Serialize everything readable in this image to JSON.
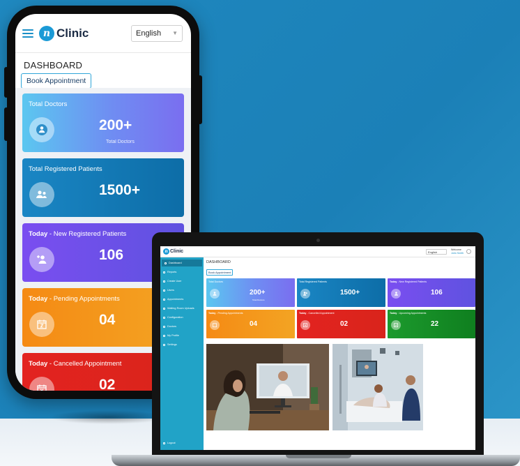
{
  "app": {
    "brand": "Clinic",
    "brand_mark": "n"
  },
  "header": {
    "language": "English",
    "welcome": "Welcome",
    "user": "John Smith"
  },
  "dashboard": {
    "title": "DASHBOARD",
    "book_button": "Book Appointment"
  },
  "cards": [
    {
      "prefix": "",
      "title": "Total Doctors",
      "value": "200+",
      "sub": "Total Doctors",
      "color": "#5bc7f0",
      "icon": "doctor-icon"
    },
    {
      "prefix": "",
      "title": "Total Registered Patients",
      "value": "1500+",
      "sub": "",
      "color": "#1a86c4",
      "icon": "patients-icon"
    },
    {
      "prefix": "Today",
      "title": " - New Registered Patients",
      "value": "106",
      "sub": "",
      "color": "#7a4ef0",
      "icon": "add-patient-icon"
    },
    {
      "prefix": "Today",
      "title": " - Pending Appointments",
      "value": "04",
      "sub": "",
      "color": "#f58a14",
      "icon": "calendar-pending-icon"
    },
    {
      "prefix": "Today",
      "title": " - Cancelled Appointment",
      "value": "02",
      "sub": "",
      "color": "#e32320",
      "icon": "calendar-cancel-icon"
    },
    {
      "prefix": "Today",
      "title": " - Upcoming Appointments",
      "value": "22",
      "sub": "",
      "color": "#1c9a2d",
      "icon": "calendar-upcoming-icon"
    }
  ],
  "sidebar": {
    "items": [
      {
        "label": "Dashboard",
        "active": true
      },
      {
        "label": "Reports"
      },
      {
        "label": "Create User"
      },
      {
        "label": "Users"
      },
      {
        "label": "Appointments"
      },
      {
        "label": "Waiting Room Uploads"
      },
      {
        "label": "Configuration"
      },
      {
        "label": "Doctors"
      },
      {
        "label": "My Profile"
      },
      {
        "label": "Settings"
      }
    ],
    "logout": "Logout"
  }
}
